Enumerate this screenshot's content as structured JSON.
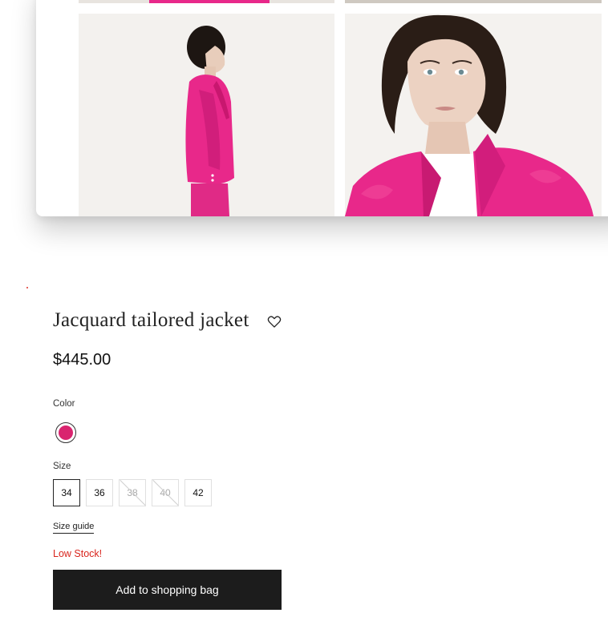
{
  "product": {
    "title": "Jacquard tailored jacket",
    "price": "$445.00",
    "color_label": "Color",
    "colors": [
      {
        "name": "pink",
        "hex": "#d9246f",
        "selected": true
      }
    ],
    "size_label": "Size",
    "sizes": [
      {
        "label": "34",
        "state": "selected"
      },
      {
        "label": "36",
        "state": "available"
      },
      {
        "label": "38",
        "state": "unavailable"
      },
      {
        "label": "40",
        "state": "unavailable"
      },
      {
        "label": "42",
        "state": "available"
      }
    ],
    "size_guide": "Size guide",
    "stock_status": "Low Stock!",
    "add_to_bag": "Add to shopping bag"
  },
  "icons": {
    "wishlist": "heart-outline-icon"
  },
  "theme": {
    "accent": "#e8288a",
    "stock_red": "#d9251d",
    "button_bg": "#1c1c1c"
  }
}
